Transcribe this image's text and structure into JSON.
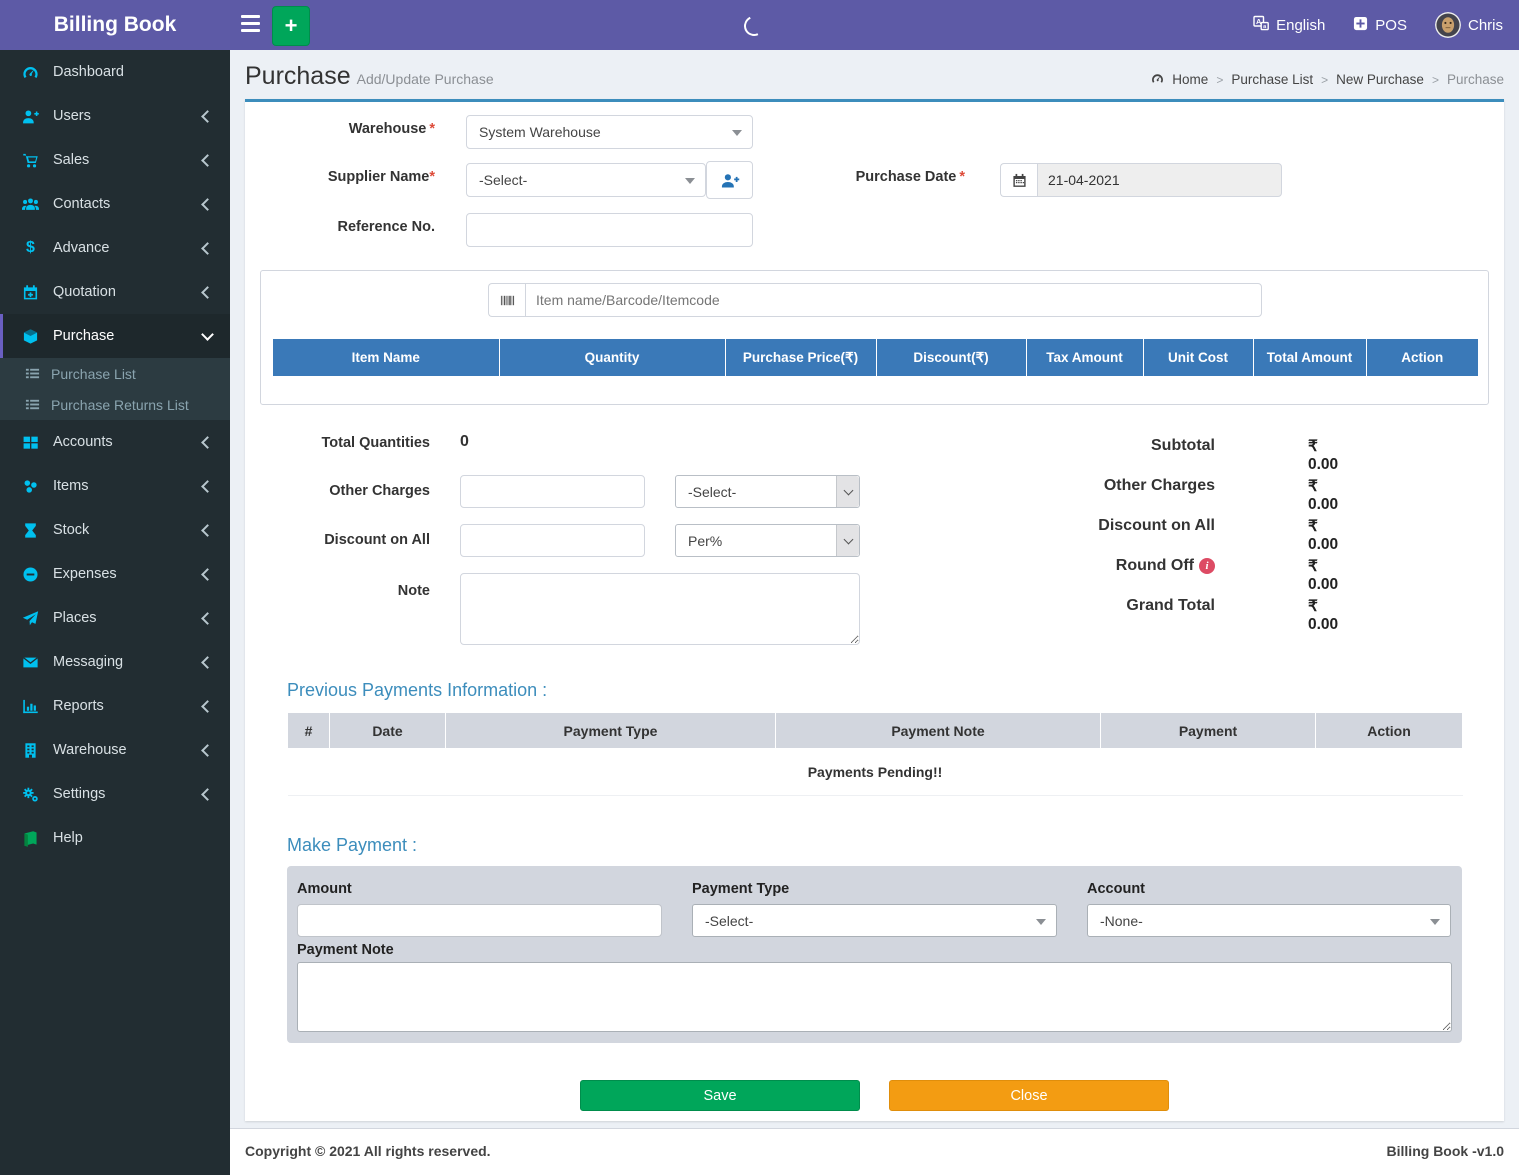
{
  "app": {
    "name": "Billing Book",
    "version": "Billing Book -v1.0",
    "copyright": "Copyright © 2021 All rights reserved."
  },
  "navbar": {
    "language": "English",
    "pos": "POS",
    "user": "Chris"
  },
  "sidebar": {
    "items": [
      {
        "label": "Dashboard"
      },
      {
        "label": "Users"
      },
      {
        "label": "Sales"
      },
      {
        "label": "Contacts"
      },
      {
        "label": "Advance"
      },
      {
        "label": "Quotation"
      },
      {
        "label": "Purchase"
      },
      {
        "label": "Accounts"
      },
      {
        "label": "Items"
      },
      {
        "label": "Stock"
      },
      {
        "label": "Expenses"
      },
      {
        "label": "Places"
      },
      {
        "label": "Messaging"
      },
      {
        "label": "Reports"
      },
      {
        "label": "Warehouse"
      },
      {
        "label": "Settings"
      },
      {
        "label": "Help"
      }
    ],
    "purchase_submenu": [
      {
        "label": "Purchase List"
      },
      {
        "label": "Purchase Returns List"
      }
    ]
  },
  "page": {
    "title": "Purchase",
    "subtitle": "Add/Update Purchase",
    "breadcrumb": {
      "home": "Home",
      "items": [
        "Purchase List",
        "New Purchase",
        "Purchase"
      ]
    }
  },
  "form": {
    "required_mark": "*",
    "warehouse": {
      "label": "Warehouse",
      "value": "System Warehouse"
    },
    "supplier": {
      "label": "Supplier Name",
      "value": "-Select-"
    },
    "purchase_date": {
      "label": "Purchase Date",
      "value": "21-04-2021"
    },
    "reference": {
      "label": "Reference No."
    }
  },
  "items_table": {
    "search_placeholder": "Item name/Barcode/Itemcode",
    "columns": [
      "Item Name",
      "Quantity",
      "Purchase Price(₹)",
      "Discount(₹)",
      "Tax Amount",
      "Unit Cost",
      "Total Amount",
      "Action"
    ]
  },
  "totals_left": {
    "quantities_label": "Total Quantities",
    "quantities_value": "0",
    "other_charges_label": "Other Charges",
    "other_charges_select": "-Select-",
    "discount_label": "Discount on All",
    "discount_select": "Per%",
    "note_label": "Note"
  },
  "totals_right": {
    "rows": [
      {
        "label": "Subtotal",
        "value": "₹ 0.00"
      },
      {
        "label": "Other Charges",
        "value": "₹ 0.00"
      },
      {
        "label": "Discount on All",
        "value": "₹ 0.00"
      },
      {
        "label": "Round Off",
        "value": "₹ 0.00"
      },
      {
        "label": "Grand Total",
        "value": "₹ 0.00"
      }
    ]
  },
  "payments": {
    "heading": "Previous Payments Information :",
    "columns": [
      "#",
      "Date",
      "Payment Type",
      "Payment Note",
      "Payment",
      "Action"
    ],
    "empty_text": "Payments Pending!!"
  },
  "make_payment": {
    "heading": "Make Payment :",
    "amount_label": "Amount",
    "payment_type_label": "Payment Type",
    "payment_type_value": "-Select-",
    "account_label": "Account",
    "account_value": "-None-",
    "note_label": "Payment Note"
  },
  "actions": {
    "save": "Save",
    "close": "Close"
  },
  "colors": {
    "header_purple": "#5d5aa6",
    "sidebar_dark": "#222d32",
    "accent_blue": "#3c8dbc",
    "table_header_blue": "#3a79b8",
    "icon_cyan": "#00c0ef",
    "save_green": "#00a65a",
    "close_orange": "#f39c12",
    "info_red": "#dd4b64"
  }
}
